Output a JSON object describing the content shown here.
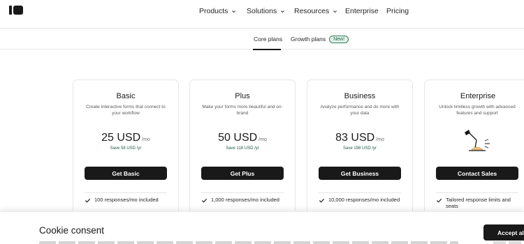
{
  "header": {
    "nav": [
      {
        "label": "Products",
        "has_dropdown": true
      },
      {
        "label": "Solutions",
        "has_dropdown": true
      },
      {
        "label": "Resources",
        "has_dropdown": true
      },
      {
        "label": "Enterprise",
        "has_dropdown": false
      },
      {
        "label": "Pricing",
        "has_dropdown": false
      }
    ]
  },
  "tabs": {
    "core": "Core plans",
    "growth": "Growth plans",
    "new_badge": "New!"
  },
  "plans": [
    {
      "name": "Basic",
      "desc": "Create interactive forms that connect to your workflow",
      "price": "25 USD",
      "per": "/mo",
      "save": "Save 58 USD /yr",
      "button": "Get Basic",
      "feature": "100 responses/mo included"
    },
    {
      "name": "Plus",
      "desc": "Make your forms more beautiful and on-brand",
      "price": "50 USD",
      "per": "/mo",
      "save": "Save 118 USD /yr",
      "button": "Get Plus",
      "feature": "1,000 responses/mo included"
    },
    {
      "name": "Business",
      "desc": "Analyze performance and do more with your data",
      "price": "83 USD",
      "per": "/mo",
      "save": "Save 198 USD /yr",
      "button": "Get Business",
      "feature": "10,000 responses/mo included"
    },
    {
      "name": "Enterprise",
      "desc": "Unlock limitless growth with advanced features and support",
      "button": "Contact Sales",
      "feature": "Tailored response limits and seats",
      "illustration": "lamp-icon"
    }
  ],
  "cookie": {
    "title": "Cookie consent",
    "accept": "Accept all"
  },
  "colors": {
    "primary": "#191919",
    "save_text": "#1e5a42",
    "badge_bg": "#e3f3ea",
    "badge_border": "#2f7d5a"
  }
}
